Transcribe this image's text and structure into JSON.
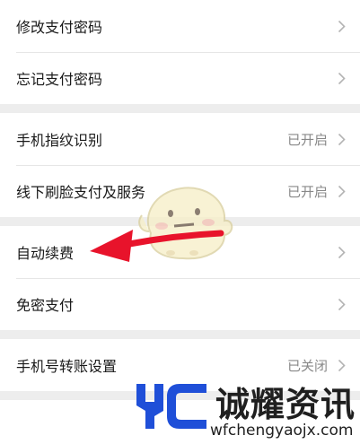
{
  "settings": {
    "group1": [
      {
        "label": "修改支付密码",
        "value": ""
      },
      {
        "label": "忘记支付密码",
        "value": ""
      }
    ],
    "group2": [
      {
        "label": "手机指纹识别",
        "value": "已开启"
      },
      {
        "label": "线下刷脸支付及服务",
        "value": "已开启"
      }
    ],
    "group3": [
      {
        "label": "自动续费",
        "value": ""
      },
      {
        "label": "免密支付",
        "value": ""
      }
    ],
    "group4": [
      {
        "label": "手机号转账设置",
        "value": "已关闭"
      }
    ]
  },
  "watermark": {
    "title": "诚耀资讯",
    "url": "wfchengyaojx.com"
  },
  "colors": {
    "background": "#ededed",
    "row_bg": "#ffffff",
    "arrow": "#e8132b",
    "watermark_blue": "#1f4fd8"
  },
  "icons": {
    "chevron": "chevron-right-icon",
    "mascot": "mascot-sticker",
    "arrow": "red-arrow-annotation"
  }
}
